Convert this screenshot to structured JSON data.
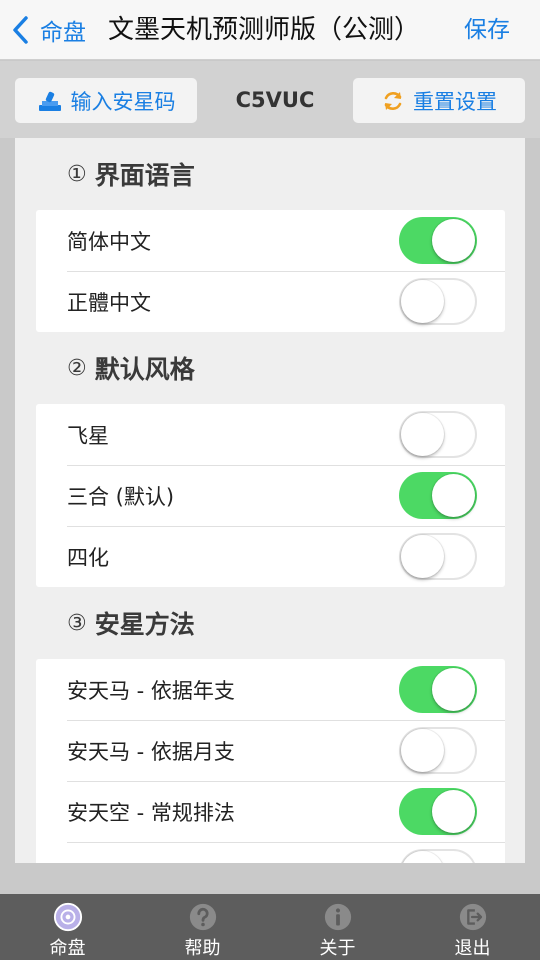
{
  "nav": {
    "back_label": "命盘",
    "title": "文墨天机预测师版（公测）",
    "save_label": "保存"
  },
  "toolbar": {
    "input_star_code_label": "输入安星码",
    "code": "C5VUC",
    "reset_label": "重置设置"
  },
  "sections": [
    {
      "number": "①",
      "title": "界面语言",
      "rows": [
        {
          "label": "简体中文",
          "on": true
        },
        {
          "label": "正體中文",
          "on": false
        }
      ]
    },
    {
      "number": "②",
      "title": "默认风格",
      "rows": [
        {
          "label": "飞星",
          "on": false
        },
        {
          "label": "三合 (默认)",
          "on": true
        },
        {
          "label": "四化",
          "on": false
        }
      ]
    },
    {
      "number": "③",
      "title": "安星方法",
      "rows": [
        {
          "label": "安天马 - 依据年支",
          "on": true
        },
        {
          "label": "安天马 - 依据月支",
          "on": false
        },
        {
          "label": "安天空 - 常规排法",
          "on": true
        },
        {
          "label": "",
          "on": false
        }
      ]
    }
  ],
  "tabs": [
    {
      "label": "命盘",
      "icon": "chart-disc-icon"
    },
    {
      "label": "帮助",
      "icon": "question-icon"
    },
    {
      "label": "关于",
      "icon": "info-icon"
    },
    {
      "label": "退出",
      "icon": "exit-icon"
    }
  ],
  "colors": {
    "accent": "#1a7fe3",
    "toggle_on": "#4cd964",
    "tabbar": "#5d5d5d",
    "reset_icon": "#f0a020"
  }
}
